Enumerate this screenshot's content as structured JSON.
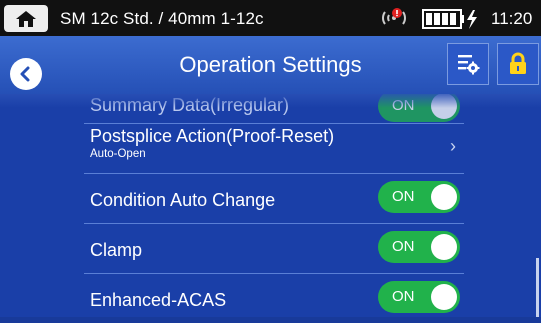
{
  "statusbar": {
    "title": "SM 12c Std. / 40mm 1-12c",
    "time": "11:20",
    "home_icon": "home-icon",
    "wifi_icon": "wifi-alert-icon",
    "battery_icon": "battery-charging-icon"
  },
  "header": {
    "title": "Operation Settings",
    "back_icon": "back-arrow-icon",
    "settings_icon": "settings-sliders-icon",
    "lock_icon": "lock-icon"
  },
  "rows": [
    {
      "label": "Summary Data(Irregular)",
      "toggle": "ON"
    },
    {
      "label": "Postsplice Action(Proof-Reset)",
      "sublabel": "Auto-Open",
      "chevron": "›"
    },
    {
      "label": "Condition Auto Change",
      "toggle": "ON"
    },
    {
      "label": "Clamp",
      "toggle": "ON"
    },
    {
      "label": "Enhanced-ACAS",
      "toggle": "ON"
    }
  ],
  "colors": {
    "background": "#1a3fa8",
    "header": "#2550b6",
    "toggle_on": "#21b24b",
    "lock": "#ffd21a"
  }
}
